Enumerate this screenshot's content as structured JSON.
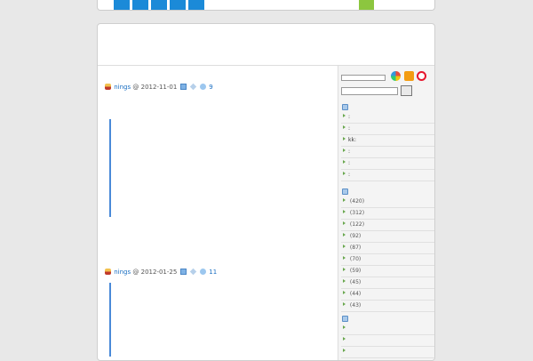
{
  "nav": {
    "tabs": [
      "",
      "",
      "",
      "",
      ""
    ]
  },
  "header": {
    "site_title": "",
    "site_description": ""
  },
  "posts": [
    {
      "title": "",
      "author": "nings",
      "at": "@",
      "date": "2012-11-01",
      "category": "",
      "tags": "",
      "comments": "9",
      "comments_suffix": "",
      "excerpt": "",
      "excerpt_link": "",
      "quote_lines": [
        "",
        "",
        "",
        "",
        "",
        "",
        "",
        "",
        "",
        "",
        "",
        ""
      ]
    },
    {
      "title": "",
      "author": "nings",
      "at": "@",
      "date": "2012-01-25",
      "category": "",
      "tags": "",
      "comments": "11",
      "comments_suffix": "",
      "quote_lines": [
        "",
        "",
        "",
        "",
        "",
        "",
        "",
        "",
        ""
      ]
    }
  ],
  "sidebar": {
    "search_button": "",
    "recent_comments": [
      {
        "author": "",
        "text": ""
      },
      {
        "author": "",
        "text": ""
      },
      {
        "author": "kk",
        "text": ""
      },
      {
        "author": "",
        "text": ""
      },
      {
        "author": "",
        "text": ""
      },
      {
        "author": "",
        "text": ""
      }
    ],
    "categories": [
      {
        "name": "",
        "count": "(420)"
      },
      {
        "name": "",
        "count": "(312)"
      },
      {
        "name": "",
        "count": "(122)"
      },
      {
        "name": "",
        "count": "(92)"
      },
      {
        "name": "",
        "count": "(87)"
      },
      {
        "name": "",
        "count": "(70)"
      },
      {
        "name": "",
        "count": "(59)"
      },
      {
        "name": "",
        "count": "(45)"
      },
      {
        "name": "",
        "count": "(44)"
      },
      {
        "name": "",
        "count": "(43)"
      }
    ],
    "pages": [
      "",
      "",
      ""
    ]
  },
  "colors": {
    "accent_blue": "#1b8ad8",
    "nav_green": "#8cc63f",
    "quote_border": "#4a8ad8"
  },
  "icons": {
    "author": "author-icon",
    "category": "folder-icon",
    "tag": "tag-icon",
    "comment": "comment-icon",
    "feed": "rss-icon",
    "weibo": "weibo-icon"
  }
}
